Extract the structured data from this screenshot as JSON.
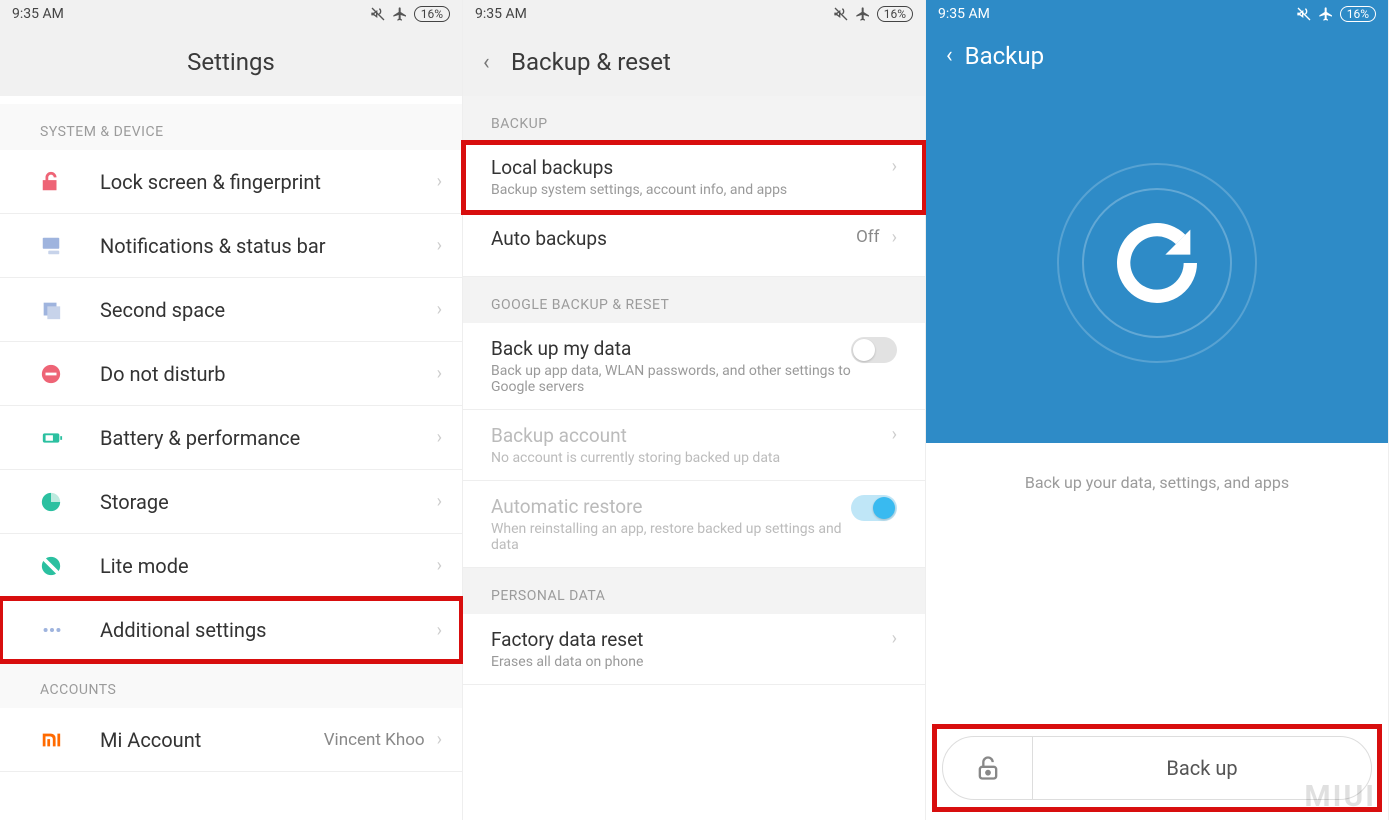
{
  "status": {
    "time": "9:35 AM",
    "battery": "16%"
  },
  "screen1": {
    "title": "Settings",
    "sections": {
      "system_device": "SYSTEM & DEVICE",
      "accounts": "ACCOUNTS"
    },
    "items": {
      "lockscreen": "Lock screen & fingerprint",
      "notifications": "Notifications & status bar",
      "second_space": "Second space",
      "dnd": "Do not disturb",
      "battery": "Battery & performance",
      "storage": "Storage",
      "litemode": "Lite mode",
      "additional": "Additional settings",
      "miaccount": "Mi Account",
      "miaccount_value": "Vincent Khoo"
    }
  },
  "screen2": {
    "title": "Backup & reset",
    "sections": {
      "backup": "BACKUP",
      "google": "GOOGLE BACKUP & RESET",
      "personal": "PERSONAL DATA"
    },
    "items": {
      "local_backups": "Local backups",
      "local_backups_sub": "Backup system settings, account info, and apps",
      "auto_backups": "Auto backups",
      "auto_backups_value": "Off",
      "backup_my_data": "Back up my data",
      "backup_my_data_sub": "Back up app data, WLAN passwords, and other settings to Google servers",
      "backup_account": "Backup account",
      "backup_account_sub": "No account is currently storing backed up data",
      "auto_restore": "Automatic restore",
      "auto_restore_sub": "When reinstalling an app, restore backed up settings and data",
      "factory_reset": "Factory data reset",
      "factory_reset_sub": "Erases all data on phone"
    }
  },
  "screen3": {
    "title": "Backup",
    "caption": "Back up your data, settings, and apps",
    "button": "Back up",
    "watermark": "MIUI"
  }
}
